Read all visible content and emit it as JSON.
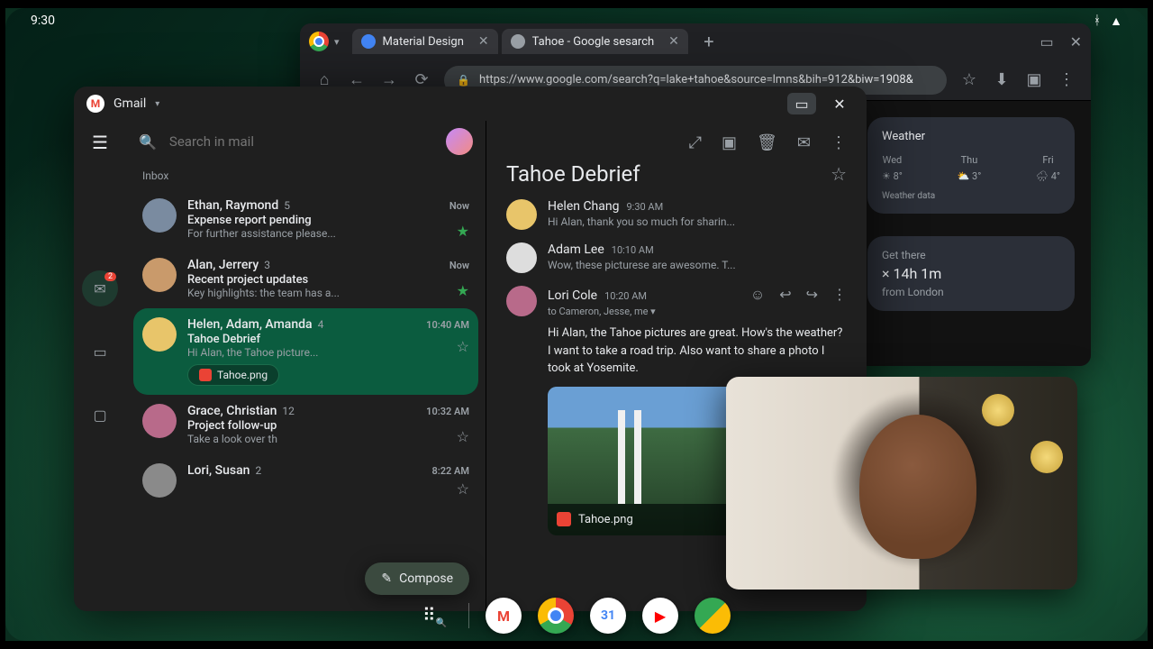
{
  "status_bar": {
    "time": "9:30"
  },
  "chrome": {
    "tabs": [
      {
        "title": "Material Design",
        "favicon_color": "#4285f4"
      },
      {
        "title": "Tahoe - Google sesarch",
        "favicon_color": "#9aa0a6"
      }
    ],
    "url": "https://www.google.com/search?q=lake+tahoe&source=lmns&bih=912&biw=1908&",
    "weather": {
      "heading": "Weather",
      "days": [
        {
          "label": "Wed",
          "temp": "8°",
          "icon": "☀"
        },
        {
          "label": "Thu",
          "temp": "3°",
          "icon": "⛅"
        },
        {
          "label": "Fri",
          "temp": "4°",
          "icon": "🌧"
        }
      ],
      "footer": "Weather data"
    },
    "travel": {
      "heading": "Get there",
      "big": "× 14h 1m",
      "sub": "from London"
    }
  },
  "gmail": {
    "app_title": "Gmail",
    "search_placeholder": "Search in mail",
    "section": "Inbox",
    "rail": {
      "mail_badge": "2"
    },
    "compose": "Compose",
    "threads": [
      {
        "senders": "Ethan, Raymond",
        "count": "5",
        "time": "Now",
        "subject": "Expense report pending",
        "snippet": "For further assistance please...",
        "starred": true,
        "selected": false
      },
      {
        "senders": "Alan, Jerrery",
        "count": "3",
        "time": "Now",
        "subject": "Recent project updates",
        "snippet": "Key highlights: the team has a...",
        "starred": true,
        "selected": false
      },
      {
        "senders": "Helen, Adam, Amanda",
        "count": "4",
        "time": "10:40 AM",
        "subject": "Tahoe Debrief",
        "snippet": "Hi Alan, the Tahoe picture...",
        "starred": false,
        "selected": true,
        "attachment": "Tahoe.png"
      },
      {
        "senders": "Grace, Christian",
        "count": "12",
        "time": "10:32 AM",
        "subject": "Project follow-up",
        "snippet": "Take a look over th",
        "starred": false,
        "selected": false
      },
      {
        "senders": "Lori, Susan",
        "count": "2",
        "time": "8:22 AM",
        "subject": "",
        "snippet": "",
        "starred": false,
        "selected": false
      }
    ],
    "read": {
      "subject": "Tahoe Debrief",
      "messages": [
        {
          "from": "Helen Chang",
          "when": "9:30 AM",
          "preview": "Hi Alan, thank you so much for sharin..."
        },
        {
          "from": "Adam Lee",
          "when": "10:10 AM",
          "preview": "Wow, these picturese are awesome. T..."
        },
        {
          "from": "Lori Cole",
          "when": "10:20 AM",
          "to": "to Cameron, Jesse, me",
          "expanded": true,
          "full": "Hi Alan, the Tahoe pictures are great. How's the weather? I want to take a road trip. Also want to share a photo I took at Yosemite.",
          "attachment": "Tahoe.png"
        }
      ]
    }
  },
  "taskbar": {
    "apps": [
      "gmail",
      "chrome",
      "calendar",
      "youtube",
      "meet"
    ]
  }
}
